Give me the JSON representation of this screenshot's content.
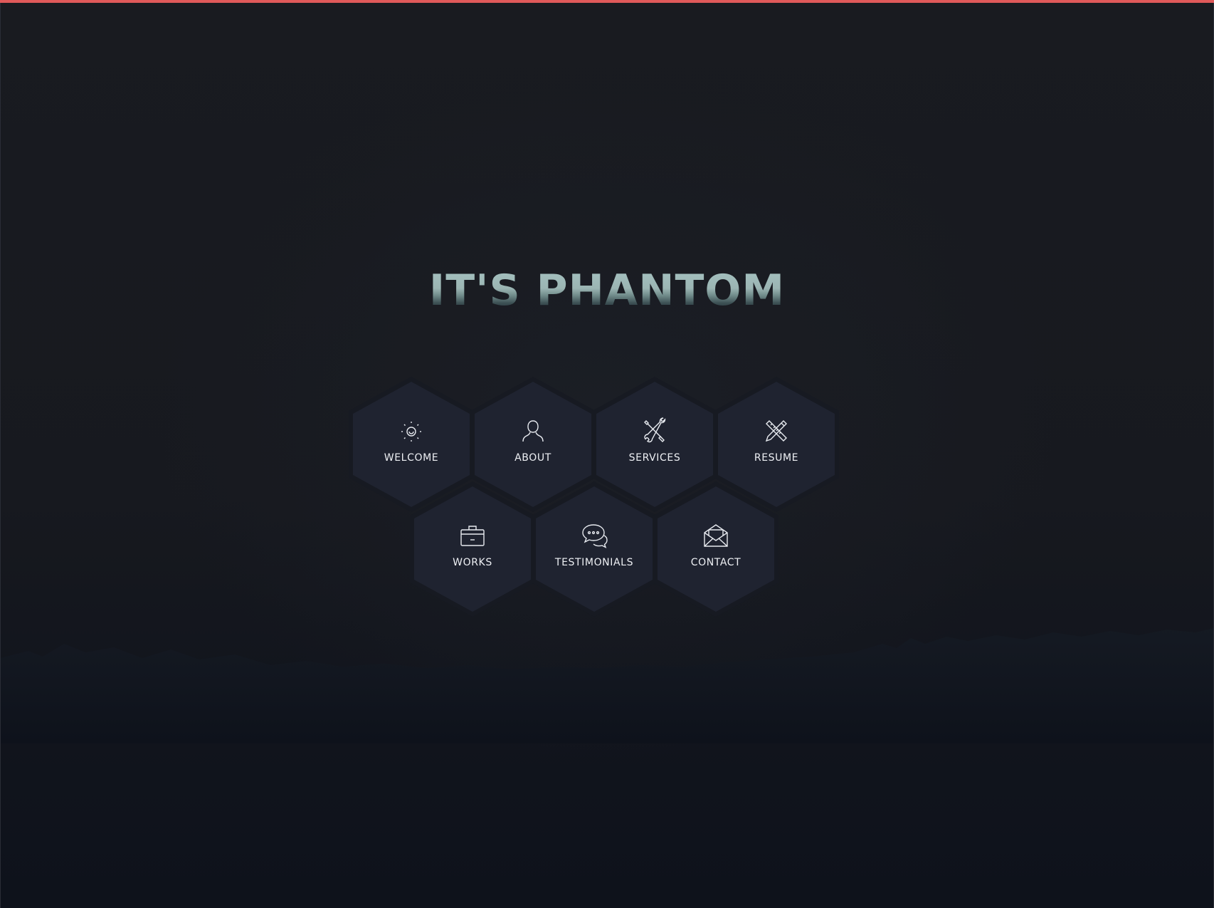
{
  "header": {
    "title": "IT'S PHANTOM",
    "accent_color": "#e05a5a"
  },
  "nav": {
    "items": [
      {
        "label": "WELCOME",
        "icon": "lightbulb-icon"
      },
      {
        "label": "ABOUT",
        "icon": "user-icon"
      },
      {
        "label": "SERVICES",
        "icon": "tools-icon"
      },
      {
        "label": "RESUME",
        "icon": "pencil-ruler-icon"
      },
      {
        "label": "WORKS",
        "icon": "briefcase-icon"
      },
      {
        "label": "TESTIMONIALS",
        "icon": "chat-bubbles-icon"
      },
      {
        "label": "CONTACT",
        "icon": "envelope-icon"
      }
    ]
  },
  "colors": {
    "background": "#14171f",
    "hex_fill": "#1f2330",
    "hex_border": "#171a22",
    "text": "#eef0f4"
  }
}
